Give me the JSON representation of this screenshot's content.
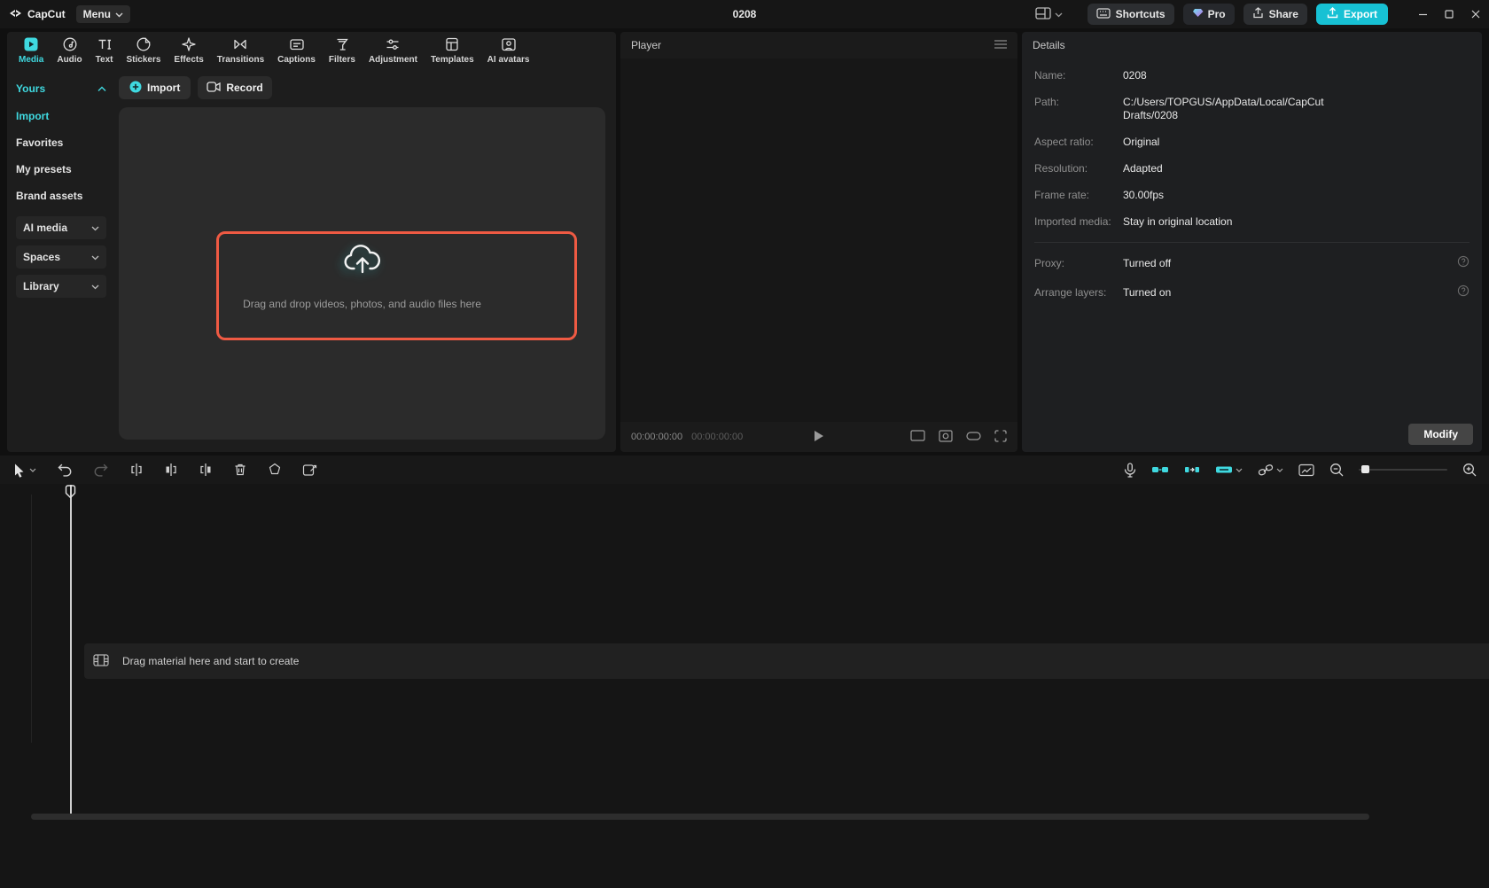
{
  "colors": {
    "accent": "#3fd9e0",
    "export_bg": "#17c1d4",
    "highlight_red": "#ef5a43"
  },
  "titlebar": {
    "app_name": "CapCut",
    "menu": "Menu",
    "title": "0208",
    "shortcuts": "Shortcuts",
    "pro": "Pro",
    "share": "Share",
    "export": "Export"
  },
  "tabs": [
    {
      "label": "Media"
    },
    {
      "label": "Audio"
    },
    {
      "label": "Text"
    },
    {
      "label": "Stickers"
    },
    {
      "label": "Effects"
    },
    {
      "label": "Transitions"
    },
    {
      "label": "Captions"
    },
    {
      "label": "Filters"
    },
    {
      "label": "Adjustment"
    },
    {
      "label": "Templates"
    },
    {
      "label": "AI avatars"
    }
  ],
  "sidebar": {
    "yours": "Yours",
    "items": [
      {
        "label": "Import"
      },
      {
        "label": "Favorites"
      },
      {
        "label": "My presets"
      },
      {
        "label": "Brand assets"
      }
    ],
    "groups": [
      {
        "label": "AI media"
      },
      {
        "label": "Spaces"
      },
      {
        "label": "Library"
      }
    ]
  },
  "media": {
    "import": "Import",
    "record": "Record",
    "dropzone": "Drag and drop videos, photos, and audio files here"
  },
  "player": {
    "title": "Player",
    "time_current": "00:00:00:00",
    "time_total": "00:00:00:00"
  },
  "details": {
    "title": "Details",
    "fields": [
      {
        "label": "Name:",
        "value": "0208"
      },
      {
        "label": "Path:",
        "value": "C:/Users/TOPGUS/AppData/Local/CapCut Drafts/0208"
      },
      {
        "label": "Aspect ratio:",
        "value": "Original"
      },
      {
        "label": "Resolution:",
        "value": "Adapted"
      },
      {
        "label": "Frame rate:",
        "value": "30.00fps"
      },
      {
        "label": "Imported media:",
        "value": "Stay in original location"
      }
    ],
    "toggles": [
      {
        "label": "Proxy:",
        "value": "Turned off"
      },
      {
        "label": "Arrange layers:",
        "value": "Turned on"
      }
    ],
    "modify": "Modify"
  },
  "timeline": {
    "empty": "Drag material here and start to create"
  }
}
